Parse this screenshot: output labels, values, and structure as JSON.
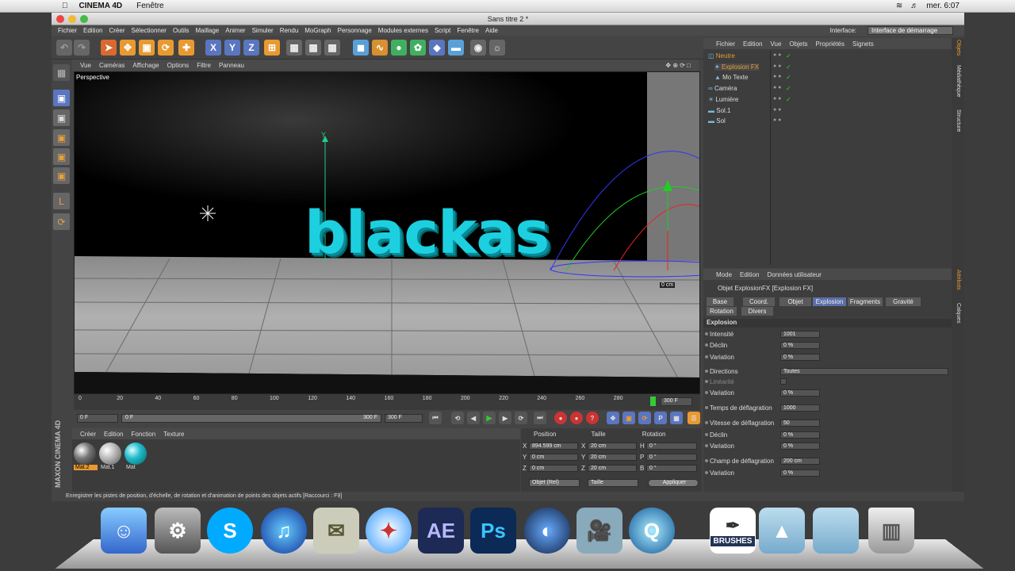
{
  "mac_menubar": {
    "app": "CINEMA 4D",
    "menu": "Fenêtre",
    "clock": "mer. 6:07"
  },
  "window": {
    "title": "Sans titre 2 *"
  },
  "menu": [
    "Fichier",
    "Edition",
    "Créer",
    "Sélectionner",
    "Outils",
    "Maillage",
    "Animer",
    "Simuler",
    "Rendu",
    "MoGraph",
    "Personnage",
    "Modules externes",
    "Script",
    "Fenêtre",
    "Aide"
  ],
  "interface": {
    "label": "Interface:",
    "value": "Interface de démarrage"
  },
  "viewport": {
    "menu": [
      "Vue",
      "Caméras",
      "Affichage",
      "Options",
      "Filtre",
      "Panneau"
    ],
    "label": "Perspective",
    "text3d": "blackas",
    "axis_y": "Y",
    "dist": "0 cm"
  },
  "timeline": {
    "ticks": [
      "0",
      "20",
      "40",
      "60",
      "80",
      "100",
      "120",
      "140",
      "160",
      "180",
      "200",
      "220",
      "240",
      "260",
      "280"
    ],
    "end": "300 F"
  },
  "transport": {
    "start": "0 F",
    "slider_left": "0 F",
    "slider_right": "300 F",
    "end": "300 F"
  },
  "materials": {
    "menu": [
      "Créer",
      "Edition",
      "Fonction",
      "Texture"
    ],
    "items": [
      "Mat.2",
      "Mat.1",
      "Mat"
    ]
  },
  "coords": {
    "headers": [
      "Position",
      "Taille",
      "Rotation"
    ],
    "rows": [
      {
        "axis": "X",
        "pos": "894.599 cm",
        "size_axis": "X",
        "size": "20 cm",
        "rot_axis": "H",
        "rot": "0 °"
      },
      {
        "axis": "Y",
        "pos": "0 cm",
        "size_axis": "Y",
        "size": "20 cm",
        "rot_axis": "P",
        "rot": "0 °"
      },
      {
        "axis": "Z",
        "pos": "0 cm",
        "size_axis": "Z",
        "size": "20 cm",
        "rot_axis": "B",
        "rot": "0 °"
      }
    ],
    "mode": "Objet (Rel)",
    "size_mode": "Taille",
    "apply": "Appliquer"
  },
  "objects": {
    "menu": [
      "Fichier",
      "Edition",
      "Vue",
      "Objets",
      "Propriétés",
      "Signets"
    ],
    "items": [
      "Neutre",
      "Explosion FX",
      "Mo Texte",
      "Caméra",
      "Lumière",
      "Sol.1",
      "Sol"
    ]
  },
  "attributes": {
    "menu": [
      "Mode",
      "Edition",
      "Données utilisateur"
    ],
    "title": "Objet ExplosionFX [Explosion FX]",
    "tabs": [
      "Base",
      "Coord.",
      "Objet",
      "Explosion",
      "Fragments",
      "Gravité",
      "Rotation",
      "Divers"
    ],
    "section": "Explosion",
    "params": [
      {
        "label": "Intensité",
        "value": "1001"
      },
      {
        "label": "Déclin",
        "value": "0 %"
      },
      {
        "label": "Variation",
        "value": "0 %"
      },
      {
        "label": "Directions",
        "value": "Toutes"
      },
      {
        "label": "Linéarité",
        "value": ""
      },
      {
        "label": "Variation",
        "value": "0 %"
      },
      {
        "label": "Temps de déflagration",
        "value": "1000"
      },
      {
        "label": "Vitesse de déflagration",
        "value": "50"
      },
      {
        "label": "Déclin",
        "value": "0 %"
      },
      {
        "label": "Variation",
        "value": "0 %"
      },
      {
        "label": "Champ de déflagration",
        "value": "200 cm"
      },
      {
        "label": "Variation",
        "value": "0 %"
      }
    ]
  },
  "sidetabs": [
    "Objets",
    "Médiathèque",
    "Structure",
    "Attributs",
    "Calques"
  ],
  "status": "Enregistrer les pistes de position, d'échelle, de rotation et d'animation de points des objets actifs [Raccourci : F9]",
  "brand": "MAXON CINEMA 4D",
  "dock": {
    "ae": "AE",
    "ps": "Ps",
    "brushes": "BRUSHES"
  }
}
